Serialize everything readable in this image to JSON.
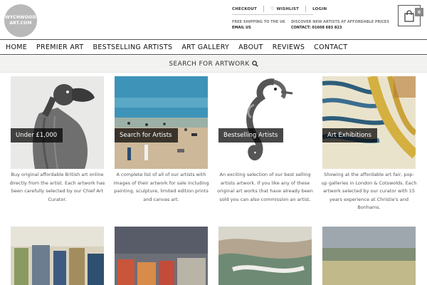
{
  "header": {
    "logo_line1": "WYCHWOOD",
    "logo_line2": "ART.COM",
    "links": [
      "CHECKOUT",
      "WISHLIST",
      "LOGIN"
    ],
    "shipping_line1": "FREE SHIPPING TO THE UK",
    "shipping_line2": "EMAIL US",
    "promo_line1": "DISCOVER NEW ARTISTS AT AFFORDABLE PRICES",
    "promo_line2": "CONTACT: 01608 683 823",
    "cart_count": "0"
  },
  "nav": {
    "items": [
      "HOME",
      "PREMIER ART",
      "BESTSELLING ARTISTS",
      "ART GALLERY",
      "ABOUT",
      "REVIEWS",
      "CONTACT"
    ]
  },
  "search": {
    "label": "SEARCH FOR ARTWORK"
  },
  "cards": [
    {
      "label": "Under £1,000",
      "description": "Buy original affordable British art online directly from the artist. Each artwork has been carefully selected by our Chief Art Curator."
    },
    {
      "label": "Search for Artists",
      "description": "A complete list of all of our artists with images of their artwork for sale including painting, sculpture, limited edition prints and canvas art."
    },
    {
      "label": "Bestselling Artists",
      "description": "An exciting selection of our best selling artists artwork. If you like any of these original art works that have already been sold you can also commission an artist."
    },
    {
      "label": "Art Exhibitions",
      "description": "Showing at the affordable art fair, pop-up galleries in London & Cotswolds. Each artwork selected by our curator with 15 years experience at Christie's and Bonhams."
    }
  ]
}
